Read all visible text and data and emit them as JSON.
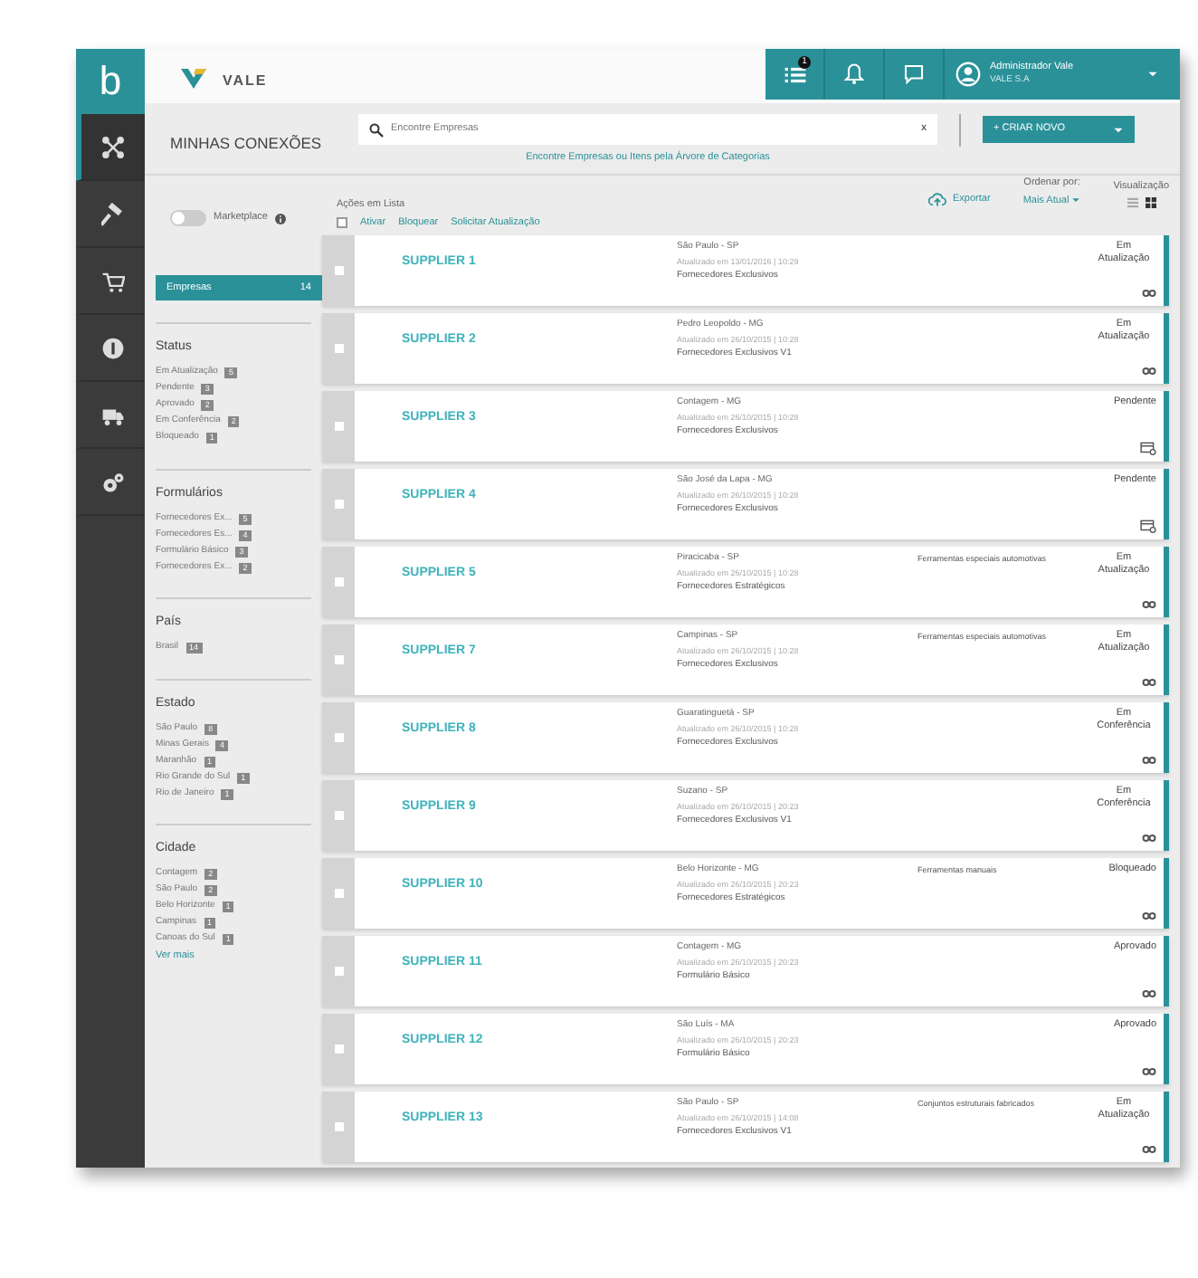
{
  "sidebar": {
    "logo": "b",
    "items": [
      {
        "kind": "network",
        "selected": true
      },
      {
        "kind": "hammer",
        "selected": false
      },
      {
        "kind": "cart",
        "selected": false
      },
      {
        "kind": "coin",
        "selected": false
      },
      {
        "kind": "truck",
        "selected": false
      },
      {
        "kind": "gears",
        "selected": false
      }
    ]
  },
  "brand": "VALE",
  "topbar": {
    "tasks_badge": "1",
    "user_name": "Administrador Vale",
    "user_company": "VALE S.A"
  },
  "page_title": "MINHAS CONEXÕES",
  "search": {
    "placeholder": "Encontre Empresas",
    "clear": "x"
  },
  "category_link": "Encontre Empresas ou Itens pela Árvore de Categorias",
  "create_button": "+ CRIAR NOVO",
  "marketplace": {
    "label": "Marketplace",
    "on": false
  },
  "list_actions": {
    "title": "Ações em Lista",
    "checked": false,
    "actions": [
      "Ativar",
      "Bloquear",
      "Solicitar Atualização"
    ]
  },
  "export": "Exportar",
  "sort": {
    "label": "Ordenar por:",
    "value": "Mais Atual"
  },
  "view": {
    "label": "Visualização",
    "options": [
      {
        "kind": "list",
        "selected": false
      },
      {
        "kind": "grid",
        "selected": true
      }
    ]
  },
  "companies_filter": {
    "label": "Empresas",
    "count": "14",
    "selected": true
  },
  "filter_groups": [
    {
      "title": "Status",
      "items": [
        {
          "label": "Em Atualização",
          "count": "5"
        },
        {
          "label": "Pendente",
          "count": "3"
        },
        {
          "label": "Aprovado",
          "count": "2"
        },
        {
          "label": "Em Conferência",
          "count": "2"
        },
        {
          "label": "Bloqueado",
          "count": "1"
        }
      ]
    },
    {
      "title": "Formulários",
      "items": [
        {
          "label": "Fornecedores Ex...",
          "count": "5"
        },
        {
          "label": "Fornecedores Es...",
          "count": "4"
        },
        {
          "label": "Formulário Básico",
          "count": "3"
        },
        {
          "label": "Fornecedores Ex...",
          "count": "2"
        }
      ]
    },
    {
      "title": "País",
      "items": [
        {
          "label": "Brasil",
          "count": "14"
        }
      ]
    },
    {
      "title": "Estado",
      "items": [
        {
          "label": "São Paulo",
          "count": "8"
        },
        {
          "label": "Minas Gerais",
          "count": "4"
        },
        {
          "label": "Maranhão",
          "count": "1"
        },
        {
          "label": "Rio Grande do Sul",
          "count": "1"
        },
        {
          "label": "Rio de Janeiro",
          "count": "1"
        }
      ]
    },
    {
      "title": "Cidade",
      "items": [
        {
          "label": "Contagem",
          "count": "2"
        },
        {
          "label": "São Paulo",
          "count": "2"
        },
        {
          "label": "Belo Horizonte",
          "count": "1"
        },
        {
          "label": "Campinas",
          "count": "1"
        },
        {
          "label": "Canoas do Sul",
          "count": "1"
        }
      ],
      "more": "Ver mais"
    }
  ],
  "suppliers": [
    {
      "name": "SUPPLIER 1",
      "location": "São Paulo - SP",
      "updated": "Atualizado em 13/01/2016 | 10:29",
      "category": "Fornecedores Exclusivos",
      "status": "Em Atualização",
      "kind": "link",
      "checked": false
    },
    {
      "name": "SUPPLIER 2",
      "location": "Pedro Leopoldo - MG",
      "updated": "Atualizado em 26/10/2015 | 10:28",
      "category": "Fornecedores Exclusivos V1",
      "status": "Em Atualização",
      "kind": "link",
      "checked": false
    },
    {
      "name": "SUPPLIER 3",
      "location": "Contagem - MG",
      "updated": "Atualizado em 26/10/2015 | 10:28",
      "category": "Fornecedores Exclusivos",
      "status": "Pendente",
      "kind": "card",
      "checked": false
    },
    {
      "name": "SUPPLIER 4",
      "location": "São José da Lapa - MG",
      "updated": "Atualizado em 26/10/2015 | 10:28",
      "category": "Fornecedores Exclusivos",
      "status": "Pendente",
      "kind": "card",
      "checked": false
    },
    {
      "name": "SUPPLIER 5",
      "location": "Piracicaba - SP",
      "updated": "Atualizado em 26/10/2015 | 10:28",
      "category": "Fornecedores Estratégicos",
      "tag": "Ferramentas especiais automotivas",
      "status": "Em Atualização",
      "kind": "link",
      "checked": false
    },
    {
      "name": "SUPPLIER 7",
      "location": "Campinas - SP",
      "updated": "Atualizado em 26/10/2015 | 10:28",
      "category": "Fornecedores Exclusivos",
      "tag": "Ferramentas especiais automotivas",
      "status": "Em Atualização",
      "kind": "link",
      "checked": false
    },
    {
      "name": "SUPPLIER 8",
      "location": "Guaratinguetá - SP",
      "updated": "Atualizado em 26/10/2015 | 10:28",
      "category": "Fornecedores Exclusivos",
      "status": "Em Conferência",
      "kind": "link",
      "checked": false
    },
    {
      "name": "SUPPLIER 9",
      "location": "Suzano - SP",
      "updated": "Atualizado em 26/10/2015 | 20:23",
      "category": "Fornecedores Exclusivos V1",
      "status": "Em Conferência",
      "kind": "link",
      "checked": false
    },
    {
      "name": "SUPPLIER 10",
      "location": "Belo Horizonte - MG",
      "updated": "Atualizado em 26/10/2015 | 20:23",
      "category": "Fornecedores Estratégicos",
      "tag": "Ferramentas manuais",
      "status": "Bloqueado",
      "kind": "link",
      "checked": false
    },
    {
      "name": "SUPPLIER 11",
      "location": "Contagem - MG",
      "updated": "Atualizado em 26/10/2015 | 20:23",
      "category": "Formulário Básico",
      "status": "Aprovado",
      "kind": "link",
      "checked": false
    },
    {
      "name": "SUPPLIER 12",
      "location": "São Luís - MA",
      "updated": "Atualizado em 26/10/2015 | 20:23",
      "category": "Formulário Básico",
      "status": "Aprovado",
      "kind": "link",
      "checked": false
    },
    {
      "name": "SUPPLIER 13",
      "location": "São Paulo - SP",
      "updated": "Atualizado em 26/10/2015 | 14:08",
      "category": "Fornecedores Exclusivos V1",
      "tag": "Conjuntos estruturais fabricados",
      "status": "Em Atualização",
      "kind": "link",
      "checked": false
    }
  ]
}
